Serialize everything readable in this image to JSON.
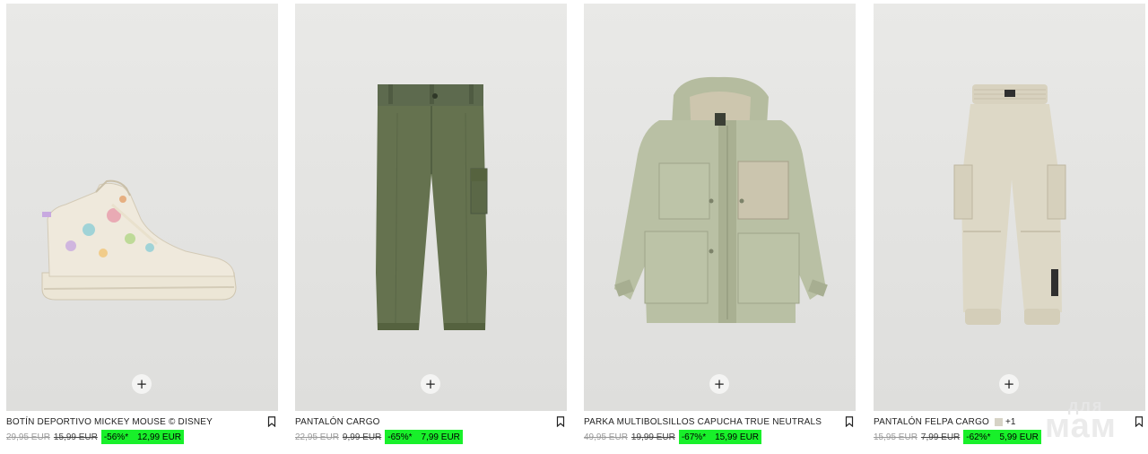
{
  "products": [
    {
      "name": "BOTÍN DEPORTIVO MICKEY MOUSE © DISNEY",
      "price_original": "29,95 EUR",
      "price_previous": "15,99 EUR",
      "discount": "-56%*",
      "price_final": "12,99 EUR",
      "add_label": "+",
      "image_icon": "sneaker-image",
      "colors": [
        "#ece5d3",
        "#e7d9c0",
        "#8ccdd6",
        "#e79aaa"
      ]
    },
    {
      "name": "PANTALÓN CARGO",
      "price_original": "22,95 EUR",
      "price_previous": "9,99 EUR",
      "discount": "-65%*",
      "price_final": "7,99 EUR",
      "add_label": "+",
      "image_icon": "cargo-pants-image",
      "colors": [
        "#5f6c4f",
        "#536046"
      ]
    },
    {
      "name": "PARKA MULTIBOLSILLOS CAPUCHA TRUE NEUTRALS",
      "price_original": "49,95 EUR",
      "price_previous": "19,99 EUR",
      "discount": "-67%*",
      "price_final": "15,99 EUR",
      "add_label": "+",
      "image_icon": "parka-image",
      "colors": [
        "#b7bea2",
        "#cfc8b2"
      ]
    },
    {
      "name": "PANTALÓN FELPA CARGO",
      "swatch_extra": "+1",
      "price_original": "15,95 EUR",
      "price_previous": "7,99 EUR",
      "discount": "-62%*",
      "price_final": "5,99 EUR",
      "add_label": "+",
      "image_icon": "sweat-cargo-pants-image",
      "colors": [
        "#ddd8c6",
        "#d2ccb8"
      ]
    }
  ],
  "watermark": {
    "line1": "для",
    "line2": "мам"
  },
  "accent_discount": "#18f02a"
}
